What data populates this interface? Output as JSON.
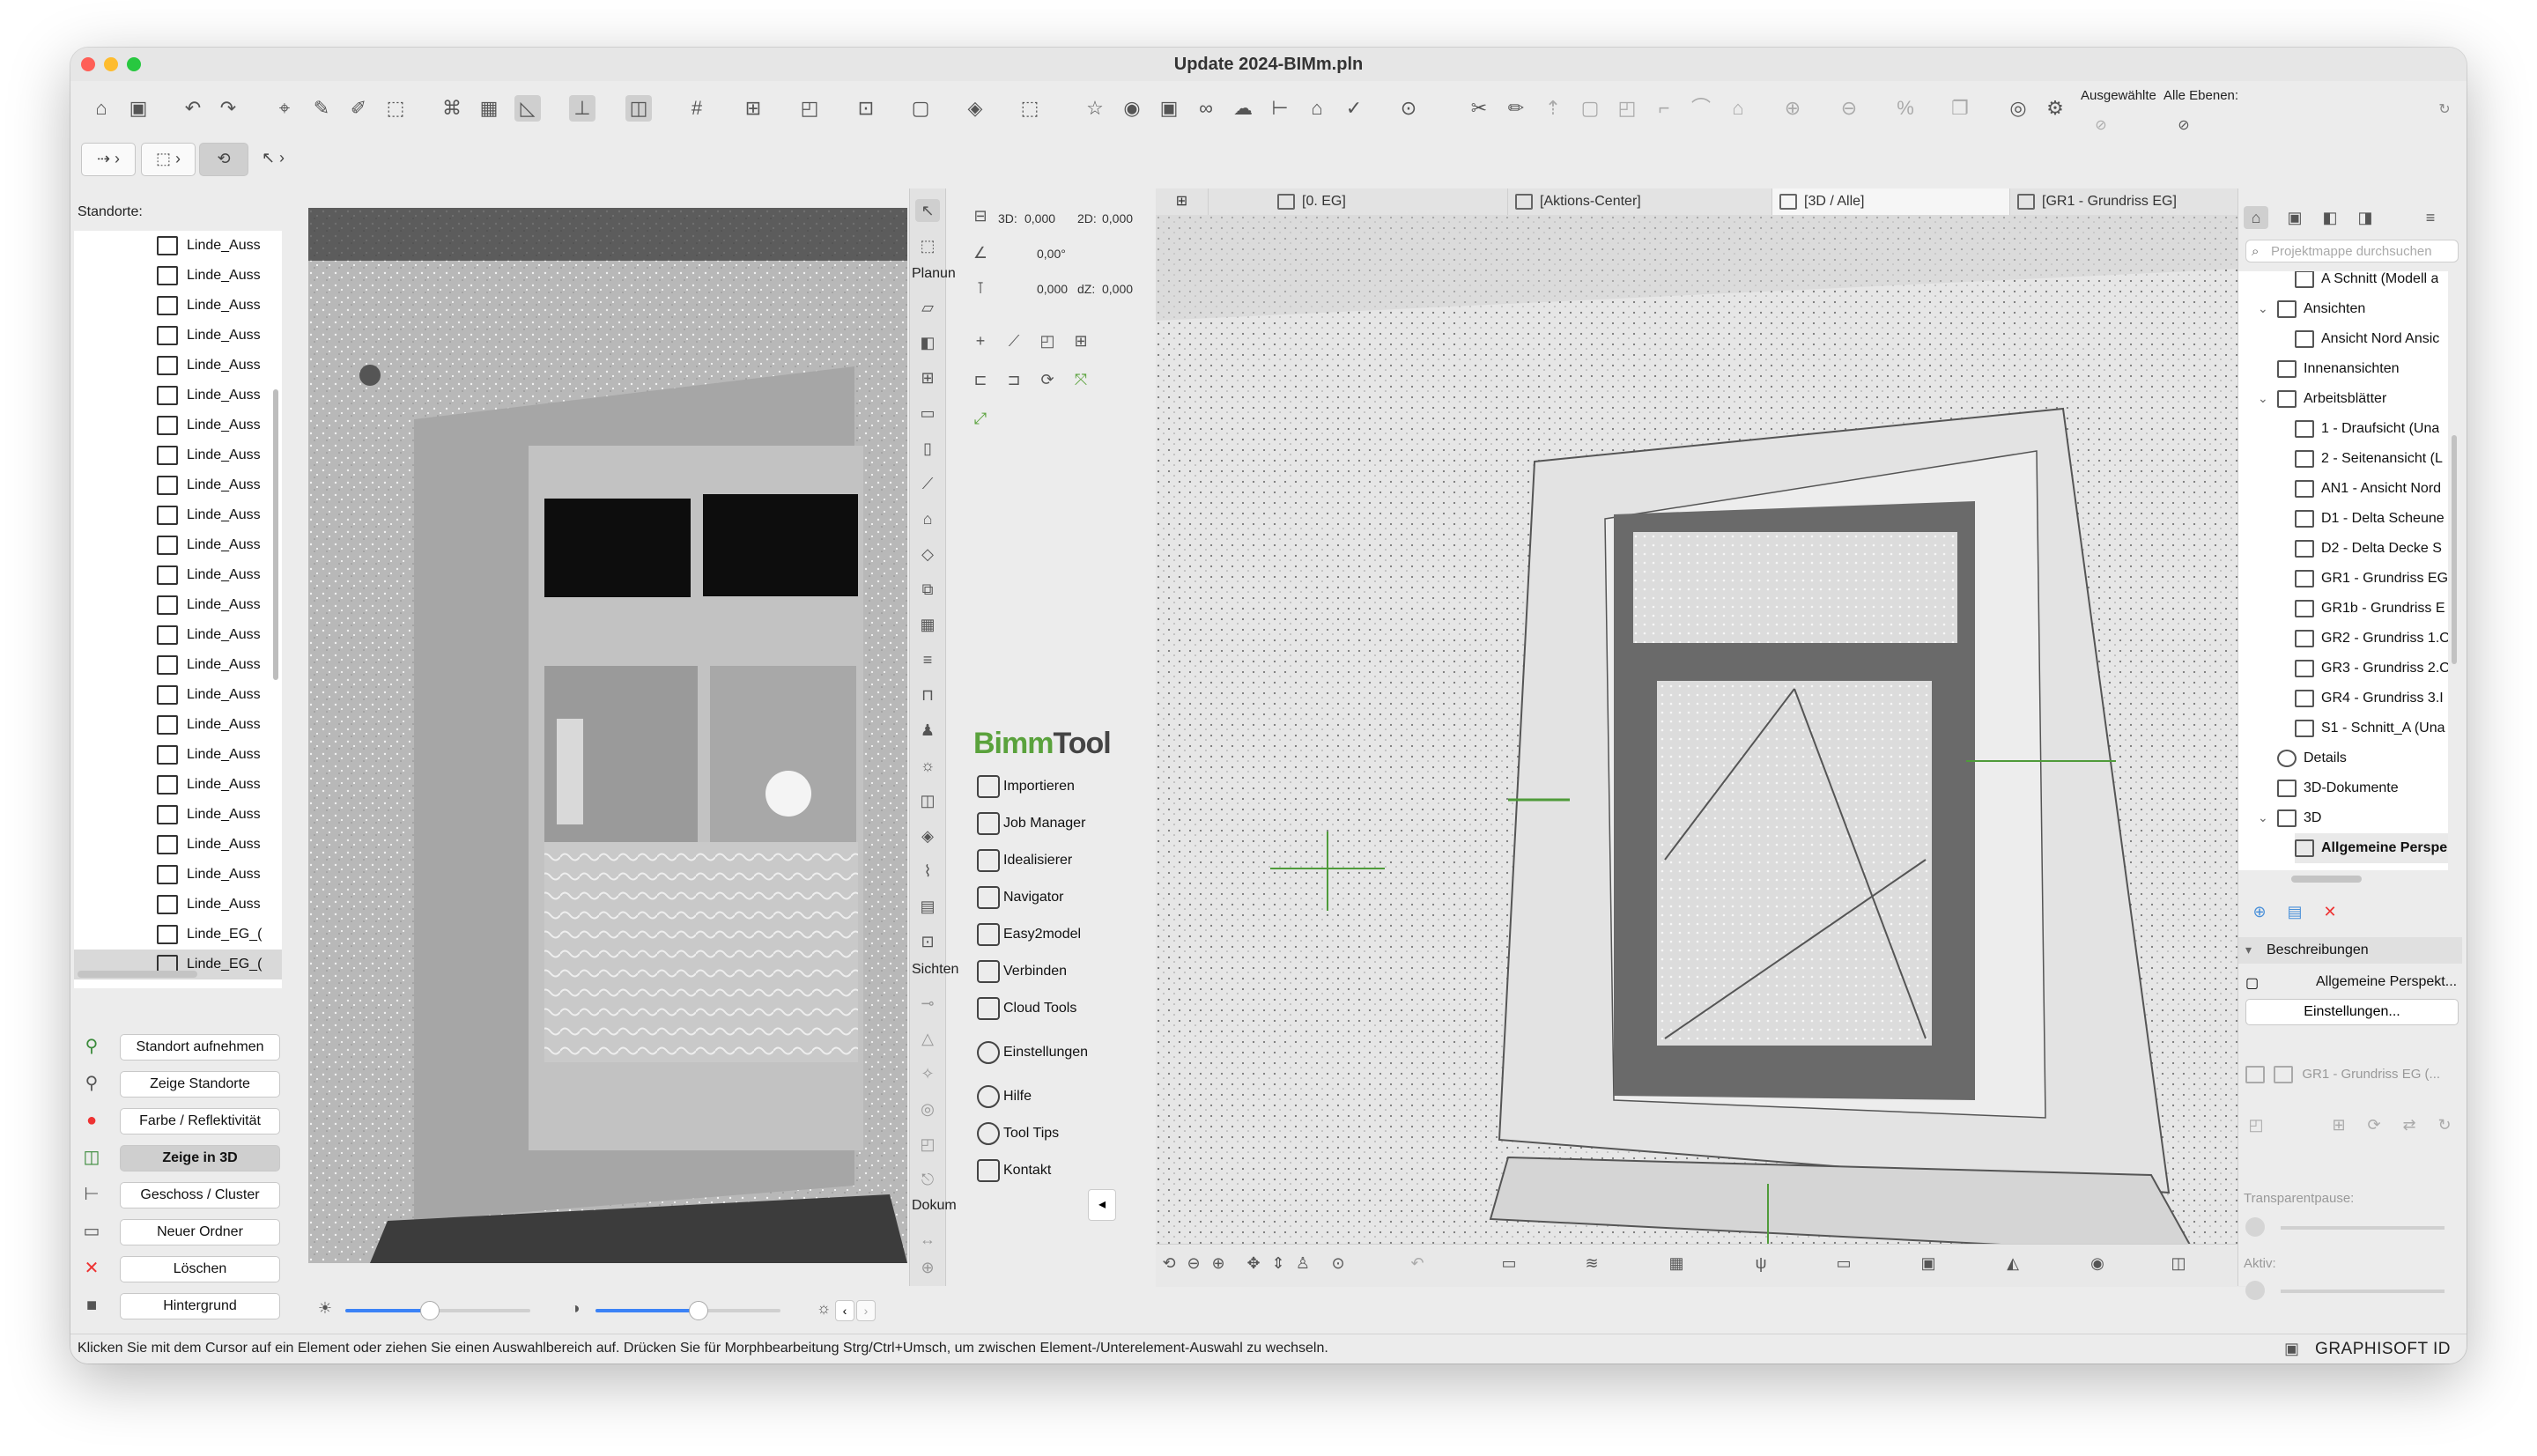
{
  "window": {
    "title": "Update 2024-BIMm.pln",
    "traffic_colors": [
      "#ff5f57",
      "#febc2e",
      "#28c840"
    ]
  },
  "toolbar": {
    "selected_label": "Ausgewählte",
    "all_layers_label": "Alle Ebenen:",
    "icons": [
      "home-icon",
      "save-icon",
      "undo-icon",
      "redo-icon",
      "select-icon",
      "pick-icon",
      "inject-icon",
      "magic-wand-icon",
      "cursor-icon",
      "calculator-icon",
      "guide-icon",
      "snap-icon",
      "grid-icon",
      "layer-icon",
      "group-icon",
      "lock-icon",
      "trace-icon",
      "find-icon",
      "favorites-icon",
      "3d-icon",
      "camera-icon",
      "cloud-icon",
      "tag-icon",
      "filter-icon",
      "marquee-icon",
      "cut-icon",
      "measure-icon",
      "move-icon",
      "rotate-icon",
      "stretch-icon",
      "scale-icon",
      "mirror-icon",
      "offset-icon",
      "cross-icon",
      "view-icon",
      "eye-icon"
    ]
  },
  "standorte": {
    "label": "Standorte:",
    "items": [
      "Linde_Auss",
      "Linde_Auss",
      "Linde_Auss",
      "Linde_Auss",
      "Linde_Auss",
      "Linde_Auss",
      "Linde_Auss",
      "Linde_Auss",
      "Linde_Auss",
      "Linde_Auss",
      "Linde_Auss",
      "Linde_Auss",
      "Linde_Auss",
      "Linde_Auss",
      "Linde_Auss",
      "Linde_Auss",
      "Linde_Auss",
      "Linde_Auss",
      "Linde_Auss",
      "Linde_Auss",
      "Linde_Auss",
      "Linde_Auss",
      "Linde_Auss",
      "Linde_EG_(",
      "Linde_EG_("
    ],
    "buttons": [
      "Standort aufnehmen",
      "Zeige Standorte",
      "Farbe / Reflektivität",
      "Zeige in 3D",
      "Geschoss / Cluster",
      "Neuer Ordner",
      "Löschen",
      "Hintergrund"
    ],
    "brightness_value": 0.45,
    "contrast_value": 0.55
  },
  "toolbox": {
    "group_planung": "Planun",
    "group_sichten": "Sichten",
    "group_doku": "Dokum"
  },
  "infobox": {
    "label_3d": "3D:",
    "val_3d": "0,000",
    "label_2d": "2D:",
    "val_2d": "0,000",
    "angle": "0,00°",
    "val_dz_left": "0,000",
    "label_dz": "dZ:",
    "val_dz": "0,000"
  },
  "bimmtool": {
    "logo_prefix": "Bimm",
    "logo_suffix": "Tool",
    "items": [
      "Importieren",
      "Job Manager",
      "Idealisierer",
      "Navigator",
      "Easy2model",
      "Verbinden",
      "Cloud Tools",
      "Einstellungen",
      "Hilfe",
      "Tool Tips",
      "Kontakt"
    ]
  },
  "tabs": {
    "eg": "[0. EG]",
    "aktions": "[Aktions-Center]",
    "view3d": "[3D / Alle]",
    "gr1": "[GR1 - Grundriss EG]"
  },
  "navigator": {
    "search_placeholder": "Projektmappe durchsuchen",
    "tree": [
      {
        "label": "A Schnitt (Modell a",
        "level": 2
      },
      {
        "label": "Ansichten",
        "level": 1,
        "expanded": true
      },
      {
        "label": "Ansicht Nord Ansic",
        "level": 2
      },
      {
        "label": "Innenansichten",
        "level": 1
      },
      {
        "label": "Arbeitsblätter",
        "level": 1,
        "expanded": true
      },
      {
        "label": "1 - Draufsicht (Una",
        "level": 2
      },
      {
        "label": "2 - Seitenansicht (L",
        "level": 2
      },
      {
        "label": "AN1 - Ansicht Nord",
        "level": 2
      },
      {
        "label": "D1 - Delta Scheune",
        "level": 2
      },
      {
        "label": "D2 - Delta Decke S",
        "level": 2
      },
      {
        "label": "GR1 - Grundriss EG",
        "level": 2
      },
      {
        "label": "GR1b - Grundriss E",
        "level": 2
      },
      {
        "label": "GR2 - Grundriss 1.O",
        "level": 2
      },
      {
        "label": "GR3 - Grundriss 2.O",
        "level": 2
      },
      {
        "label": "GR4 - Grundriss 3.I",
        "level": 2
      },
      {
        "label": "S1 - Schnitt_A (Una",
        "level": 2
      },
      {
        "label": "Details",
        "level": 1
      },
      {
        "label": "3D-Dokumente",
        "level": 1
      },
      {
        "label": "3D",
        "level": 1,
        "expanded": true
      },
      {
        "label": "Allgemeine Perspe",
        "level": 2,
        "selected": true
      }
    ],
    "section_beschreibungen": "Beschreibungen",
    "beschreibung_item": "Allgemeine Perspekt...",
    "einstellungen": "Einstellungen...",
    "layout_ref": "GR1 - Grundriss EG (...",
    "transparent_label": "Transparentpause:",
    "aktiv_label": "Aktiv:"
  },
  "statusbar": {
    "message": "Klicken Sie mit dem Cursor auf ein Element oder ziehen Sie einen Auswahlbereich auf. Drücken Sie für Morphbearbeitung Strg/Ctrl+Umsch, um zwischen Element-/Unterelement-Auswahl zu wechseln.",
    "brand": "GRAPHISOFT ID"
  }
}
